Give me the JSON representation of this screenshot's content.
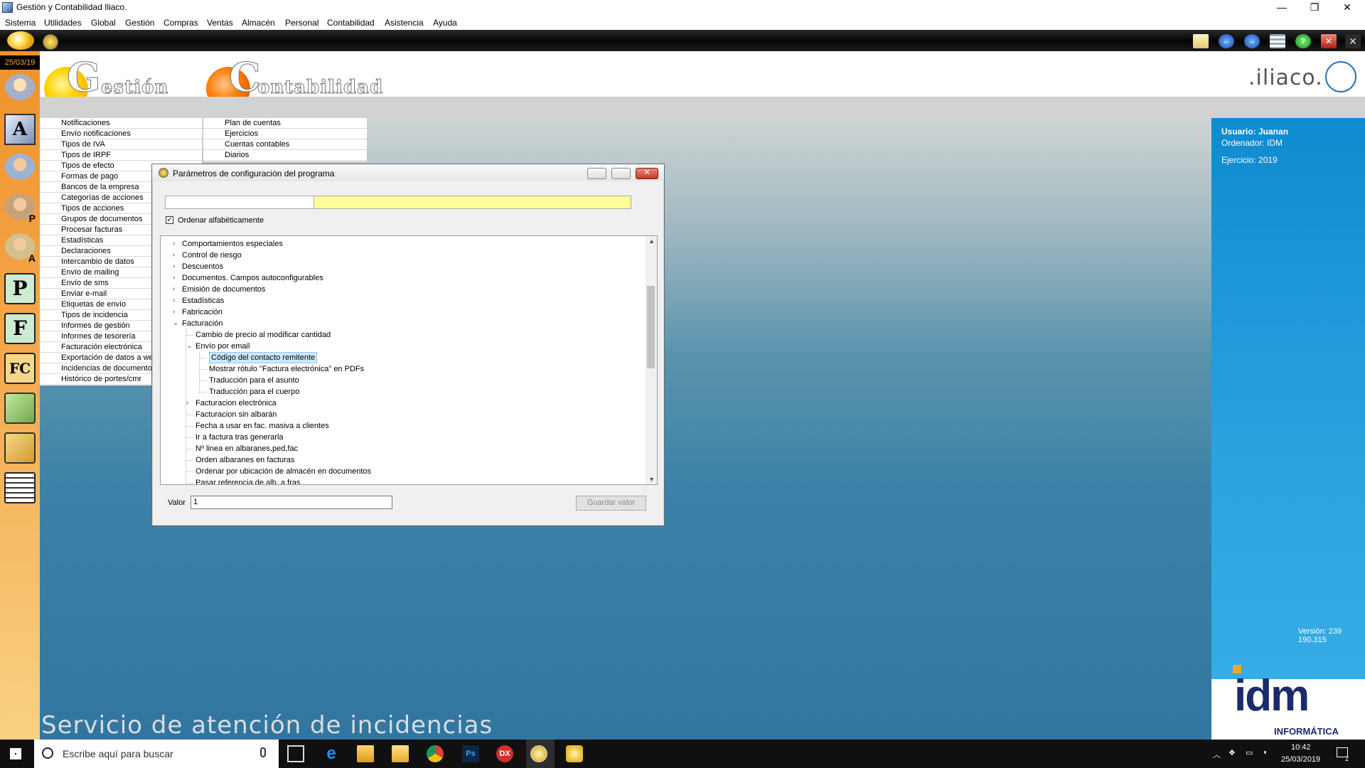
{
  "window": {
    "title": "Gestión y Contabilidad Iliaco.",
    "controls": [
      "—",
      "❐",
      "✕"
    ]
  },
  "menu": [
    "Sistema",
    "Utilidades",
    "Global",
    "Gestión",
    "Compras",
    "Ventas",
    "Almacén",
    "Personal",
    "Contabilidad",
    "Asistencia",
    "Ayuda"
  ],
  "date_badge": "25/03/19",
  "header": {
    "gestion_letter": "G",
    "gestion_rest": "estión",
    "conta_letter": "C",
    "conta_rest": "ontabilidad",
    "brand": ".iliaco."
  },
  "left_menu": [
    "Notificaciones",
    "Envío notificaciones",
    "Tipos de IVA",
    "Tipos de IRPF",
    "Tipos de efecto",
    "Formas de pago",
    "Bancos de la empresa",
    "Categorías de acciones",
    "Tipos de acciones",
    "Grupos de documentos",
    "Procesar facturas",
    "Estadísticas",
    "Declaraciones",
    "Intercambio de datos",
    "Envío de mailing",
    "Envío de sms",
    "Enviar e-mail",
    "Etiquetas de envío",
    "Tipos de incidencia",
    "Informes de gestión",
    "Informes de tesorería",
    "Facturación electrónica",
    "Exportación de datos a we",
    "Incidencias de documentos",
    "Histórico de portes/cmr"
  ],
  "right_menu": [
    "Plan de cuentas",
    "Ejercicios",
    "Cuentas contables",
    "Diarios"
  ],
  "info": {
    "usuario": "Usuario: Juanan",
    "ordenador": "Ordenador: IDM",
    "ejercicio": "Ejercicio: 2019",
    "version": "Versión: 239 190.315"
  },
  "idm": {
    "logo": "idm",
    "sub": "INFORMÁTICA"
  },
  "service_text": "Servicio de atención de incidencias",
  "dialog": {
    "title": "Parámetros de configuración del programa",
    "checkbox_label": "Ordenar alfabéticamente",
    "tree": [
      {
        "label": "Comportamientos especiales",
        "level": 0,
        "arrow": "›"
      },
      {
        "label": "Control de riesgo",
        "level": 0,
        "arrow": "›"
      },
      {
        "label": "Descuentos",
        "level": 0,
        "arrow": "›"
      },
      {
        "label": "Documentos. Campos autoconfigurables",
        "level": 0,
        "arrow": "›"
      },
      {
        "label": "Emisión de documentos",
        "level": 0,
        "arrow": "›"
      },
      {
        "label": "Estadísticas",
        "level": 0,
        "arrow": "›"
      },
      {
        "label": "Fabricación",
        "level": 0,
        "arrow": "›"
      },
      {
        "label": "Facturación",
        "level": 0,
        "arrow": "⌄"
      },
      {
        "label": "Cambio de precio al modificar cantidad",
        "level": 1,
        "arrow": ""
      },
      {
        "label": "Envío por email",
        "level": 1,
        "arrow": "⌄"
      },
      {
        "label": "Código del contacto remitente",
        "level": 2,
        "arrow": "",
        "selected": true
      },
      {
        "label": "Mostrar rótulo \"Factura electrónica\" en PDFs",
        "level": 2,
        "arrow": ""
      },
      {
        "label": "Traducción para el asunto",
        "level": 2,
        "arrow": ""
      },
      {
        "label": "Traducción para el cuerpo",
        "level": 2,
        "arrow": ""
      },
      {
        "label": "Facturacion electrónica",
        "level": 1,
        "arrow": "›"
      },
      {
        "label": "Facturacion sin albarán",
        "level": 1,
        "arrow": ""
      },
      {
        "label": "Fecha a usar en fac. masiva a clientes",
        "level": 1,
        "arrow": ""
      },
      {
        "label": "Ir a factura tras generarla",
        "level": 1,
        "arrow": ""
      },
      {
        "label": "Nº linea en albaranes,ped,fac",
        "level": 1,
        "arrow": ""
      },
      {
        "label": "Orden albaranes en facturas",
        "level": 1,
        "arrow": ""
      },
      {
        "label": "Ordenar por ubicación de almacén en documentos",
        "level": 1,
        "arrow": ""
      },
      {
        "label": "Pasar referencia de alb. a fras",
        "level": 1,
        "arrow": ""
      }
    ],
    "valor_label": "Valor",
    "valor_value": "1",
    "save_label": "Guardar valor"
  },
  "taskbar": {
    "search_placeholder": "Escribe aquí para buscar",
    "time": "10:42",
    "date": "25/03/2019",
    "notif_count": "2"
  },
  "colors": {
    "accent_orange": "#f0922a",
    "panel_blue": "#0f8bd1",
    "search_yellow": "#ffff99"
  }
}
